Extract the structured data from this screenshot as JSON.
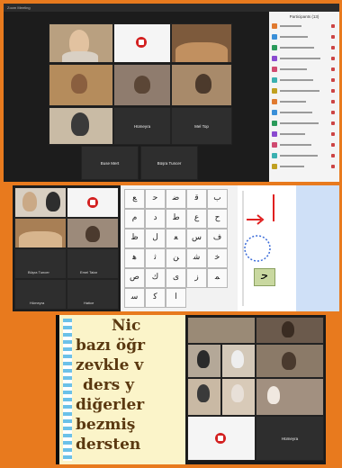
{
  "top_window": {
    "title": "Zoom Meeting",
    "tiles": [
      {
        "name": "",
        "kind": "video"
      },
      {
        "name": "",
        "kind": "logo"
      },
      {
        "name": "",
        "kind": "video"
      },
      {
        "name": "",
        "kind": "video"
      },
      {
        "name": "",
        "kind": "video"
      },
      {
        "name": "",
        "kind": "video"
      },
      {
        "name": "",
        "kind": "video"
      },
      {
        "name": "",
        "kind": "blank",
        "label": "Hümeyra"
      },
      {
        "name": "",
        "kind": "blank",
        "label": "Mel Top"
      },
      {
        "name": "",
        "kind": "blank",
        "label": "Buse Mert"
      },
      {
        "name": "",
        "kind": "blank",
        "label": "Büşra Tuncer"
      }
    ],
    "participants_header": "Participants (13)",
    "participants_count": 14
  },
  "mid_left": {
    "tiles": [
      {
        "label": ""
      },
      {
        "label": ""
      },
      {
        "label": ""
      },
      {
        "label": ""
      },
      {
        "label": "Büşra Tuncer"
      },
      {
        "label": "Emel Tatar"
      },
      {
        "label": "Hümeyra"
      },
      {
        "label": "Hatice"
      }
    ]
  },
  "board": {
    "glyphs": [
      "ﻊ",
      "ﺣ",
      "ﺿ",
      "ﻗ",
      "ﺏ",
      "ﻡ",
      "ﺩ",
      "ﻁ",
      "ﻉ",
      "ﺡ",
      "ﻅ",
      "ﻝ",
      "ﻌ",
      "ﺱ",
      "ﻑ",
      "ﻫ",
      "ﺛ",
      "ﻦ",
      "ﺷ",
      "ﺧ",
      "ﺹ",
      "ﻙ",
      "ﻯ",
      "ﺯ",
      "ﻤ",
      "ﺳ",
      "ﻛ",
      "ﺍ"
    ],
    "side_glyph": "ﺣ"
  },
  "slide": {
    "lines": [
      "Nic",
      "bazı öğr",
      "zevkle v",
      "ders y",
      "diğerler",
      "bezmiş",
      "dersten"
    ]
  },
  "bottom_grid": {
    "caption": "Hümeyra"
  },
  "colors": {
    "frame": "#e87a1e",
    "zoom_bg": "#1c1c1c",
    "slide_bg": "#fbf4c9",
    "slide_text": "#5a3810",
    "logo_red": "#d32020"
  }
}
